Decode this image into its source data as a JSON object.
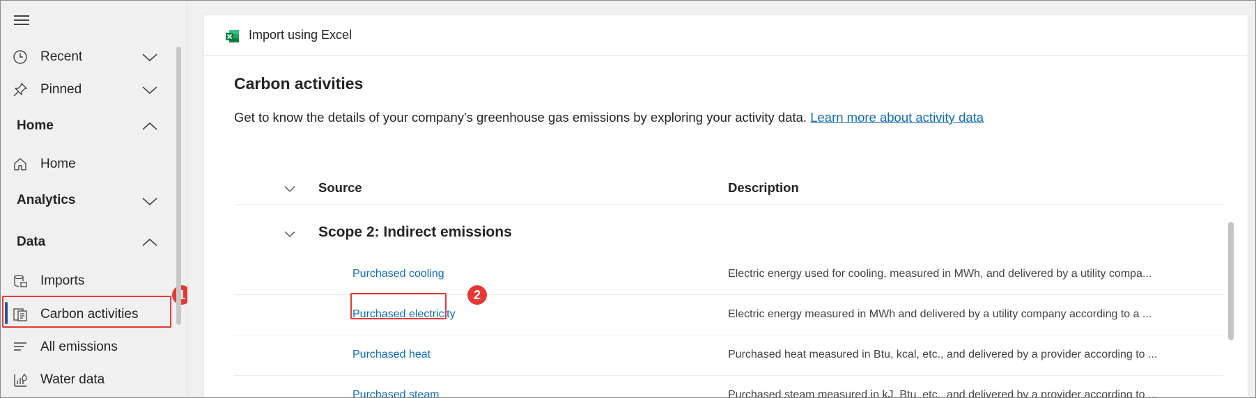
{
  "sidebar": {
    "items": [
      {
        "label": "Recent",
        "icon": "clock-icon"
      },
      {
        "label": "Pinned",
        "icon": "pin-icon"
      },
      {
        "label": "Home",
        "icon": "home-icon"
      },
      {
        "label": "Imports",
        "icon": "database-icon"
      },
      {
        "label": "Carbon activities",
        "icon": "document-list-icon"
      },
      {
        "label": "All emissions",
        "icon": "lines-icon"
      },
      {
        "label": "Water data",
        "icon": "water-chart-icon"
      }
    ],
    "sections": [
      {
        "label": "Home"
      },
      {
        "label": "Analytics"
      },
      {
        "label": "Data"
      }
    ]
  },
  "toolbar": {
    "import_label": "Import using Excel"
  },
  "page": {
    "title": "Carbon activities",
    "description": "Get to know the details of your company's greenhouse gas emissions by exploring your activity data.",
    "learn_more_link": "Learn more about activity data"
  },
  "grid": {
    "columns": {
      "source": "Source",
      "description": "Description"
    },
    "group": {
      "label": "Scope 2: Indirect emissions"
    },
    "rows": [
      {
        "source": "Purchased cooling",
        "description": "Electric energy used for cooling, measured in MWh, and delivered by a utility compa..."
      },
      {
        "source": "Purchased electricity",
        "description": "Electric energy measured in MWh and delivered by a utility company according to a ..."
      },
      {
        "source": "Purchased heat",
        "description": "Purchased heat measured in Btu, kcal, etc., and delivered by a provider according to ..."
      },
      {
        "source": "Purchased steam",
        "description": "Purchased steam measured in kJ, Btu, etc., and delivered by a provider according to ..."
      }
    ]
  },
  "annotations": {
    "badge1": "1",
    "badge2": "2"
  },
  "colors": {
    "accent": "#0f6cbd",
    "highlight": "#e53935",
    "active_indicator": "#2b579a",
    "excel_green": "#107c41"
  }
}
